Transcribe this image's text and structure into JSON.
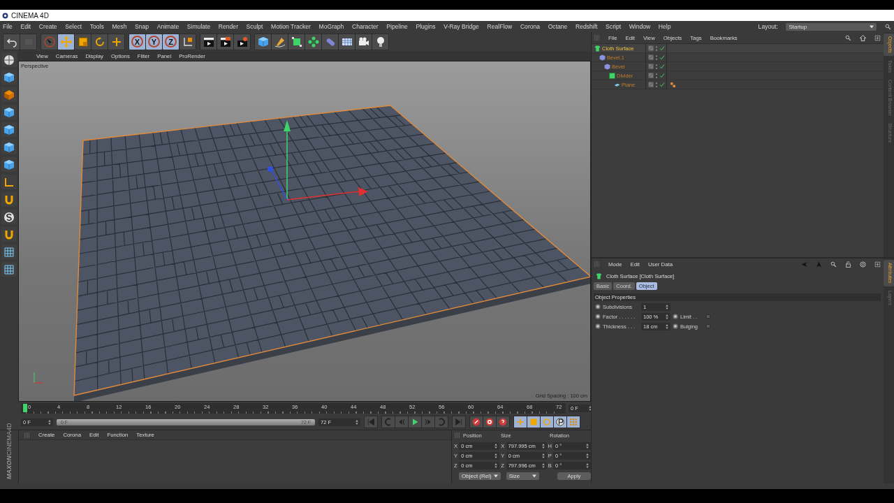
{
  "window": {
    "title": "CINEMA 4D"
  },
  "menu_bar": [
    "File",
    "Edit",
    "Create",
    "Select",
    "Tools",
    "Mesh",
    "Snap",
    "Animate",
    "Simulate",
    "Render",
    "Sculpt",
    "Motion Tracker",
    "MoGraph",
    "Character",
    "Pipeline",
    "Plugins",
    "V-Ray Bridge",
    "RealFlow",
    "Corona",
    "Octane",
    "Redshift",
    "Script",
    "Window",
    "Help"
  ],
  "layout": {
    "label": "Layout:",
    "value": "Startup"
  },
  "toolbar": [
    {
      "kind": "undo",
      "selected": false
    },
    {
      "kind": "redo",
      "selected": false
    },
    {
      "kind": "select",
      "selected": false
    },
    {
      "kind": "move",
      "selected": true
    },
    {
      "kind": "scale",
      "selected": false
    },
    {
      "kind": "rotate",
      "selected": false
    },
    {
      "kind": "add",
      "selected": false
    },
    {
      "kind": "axis",
      "label": "X",
      "selected": true
    },
    {
      "kind": "axis",
      "label": "Y",
      "selected": true
    },
    {
      "kind": "axis",
      "label": "Z",
      "selected": true
    },
    {
      "kind": "coords",
      "selected": false
    },
    {
      "kind": "render-view",
      "selected": false
    },
    {
      "kind": "render",
      "selected": false
    },
    {
      "kind": "render-settings",
      "selected": false
    },
    {
      "kind": "cube",
      "selected": false
    },
    {
      "kind": "pen",
      "selected": false
    },
    {
      "kind": "subdiv",
      "selected": false
    },
    {
      "kind": "cloner",
      "selected": false
    },
    {
      "kind": "deformer",
      "selected": false
    },
    {
      "kind": "floor",
      "selected": false
    },
    {
      "kind": "camera",
      "selected": false
    },
    {
      "kind": "light",
      "selected": false
    }
  ],
  "left_tools": [
    {
      "kind": "sphere"
    },
    {
      "kind": "cube"
    },
    {
      "kind": "checker"
    },
    {
      "kind": "cube"
    },
    {
      "kind": "cube"
    },
    {
      "kind": "cube"
    },
    {
      "kind": "cube"
    },
    {
      "kind": "axis"
    },
    {
      "kind": "magnet"
    },
    {
      "kind": "snap"
    },
    {
      "kind": "magnet"
    },
    {
      "kind": "grid"
    },
    {
      "kind": "grid"
    }
  ],
  "viewport": {
    "menu": [
      "View",
      "Cameras",
      "Display",
      "Options",
      "Filter",
      "Panel",
      "ProRender"
    ],
    "camera": "Perspective",
    "grid_spacing": "Grid Spacing : 100 cm"
  },
  "timeline": {
    "ticks": [
      "0",
      "4",
      "8",
      "12",
      "16",
      "20",
      "24",
      "28",
      "32",
      "36",
      "40",
      "44",
      "48",
      "52",
      "56",
      "60",
      "64",
      "68",
      "72"
    ],
    "level": 0,
    "current": "0 F",
    "start": "0 F",
    "range": {
      "start": "0 F",
      "end": "72 F",
      "level": 1
    },
    "end": "72 F",
    "transport": [
      {
        "kind": "first"
      },
      {
        "kind": "prev-key"
      },
      {
        "kind": "prev-frame"
      },
      {
        "kind": "play"
      },
      {
        "kind": "next-frame"
      },
      {
        "kind": "next-key"
      },
      {
        "kind": "last"
      }
    ],
    "record": [
      {
        "kind": "record"
      },
      {
        "kind": "autokey"
      },
      {
        "kind": "keyframe"
      }
    ],
    "key_modes": [
      {
        "kind": "move",
        "selected": true
      },
      {
        "kind": "scale",
        "selected": true
      },
      {
        "kind": "rotate",
        "selected": true
      },
      {
        "kind": "param",
        "selected": true
      },
      {
        "kind": "points",
        "selected": true
      }
    ]
  },
  "material_manager": {
    "menu": [
      "Create",
      "Corona",
      "Edit",
      "Function",
      "Texture"
    ],
    "logo": {
      "brand": "MAXON",
      "product": "CINEMA4D"
    }
  },
  "coordinates": {
    "headers": [
      "Position",
      "Size",
      "Rotation"
    ],
    "rows": [
      {
        "axis": "X",
        "position": "0 cm",
        "size_axis": "X",
        "size": "797.995 cm",
        "rotation_axis": "H",
        "rotation": "0 °"
      },
      {
        "axis": "Y",
        "position": "0 cm",
        "size_axis": "Y",
        "size": "0 cm",
        "rotation_axis": "P",
        "rotation": "0 °"
      },
      {
        "axis": "Z",
        "position": "0 cm",
        "size_axis": "Z",
        "size": "797.996 cm",
        "rotation_axis": "B",
        "rotation": "0 °"
      }
    ],
    "mode": "Object (Rel)",
    "size_mode": "Size",
    "apply": "Apply"
  },
  "object_manager": {
    "menu": [
      "File",
      "Edit",
      "View",
      "Objects",
      "Tags",
      "Bookmarks"
    ],
    "tree": [
      {
        "name": "Cloth Surface",
        "kind": "cloth",
        "selected": true,
        "has_tag": false,
        "children": [
          {
            "name": "Bevel.1",
            "kind": "bevel",
            "selected": false,
            "has_tag": false,
            "children": [
              {
                "name": "Bevel",
                "kind": "bevel",
                "selected": false,
                "has_tag": false,
                "children": [
                  {
                    "name": "Divider",
                    "kind": "connect",
                    "selected": false,
                    "has_tag": false,
                    "children": [
                      {
                        "name": "Plane",
                        "kind": "plane",
                        "selected": false,
                        "has_tag": true
                      }
                    ]
                  }
                ]
              }
            ]
          }
        ]
      }
    ],
    "side_tabs": [
      {
        "label": "Objects",
        "selected": true
      },
      {
        "label": "Takes",
        "selected": false
      },
      {
        "label": "Content Browser",
        "selected": false
      },
      {
        "label": "Structure",
        "selected": false
      }
    ]
  },
  "attributes": {
    "menu": [
      "Mode",
      "Edit",
      "User Data"
    ],
    "title": "Cloth Surface [Cloth Surface]",
    "tabs": [
      {
        "label": "Basic",
        "selected": false
      },
      {
        "label": "Coord.",
        "selected": false
      },
      {
        "label": "Object",
        "selected": true
      }
    ],
    "section": "Object Properties",
    "fields": [
      {
        "label": "Subdivisions",
        "value": "1"
      },
      {
        "label": "Factor . . . . . .",
        "value": "100 %",
        "option": {
          "label": "Limit . .",
          "checked": false
        }
      },
      {
        "label": "Thickness . . .",
        "value": "18 cm",
        "option": {
          "label": "Bulging",
          "checked": false
        }
      }
    ],
    "side_tabs": [
      {
        "label": "Attributes",
        "selected": true
      },
      {
        "label": "Layers",
        "selected": false
      }
    ]
  }
}
